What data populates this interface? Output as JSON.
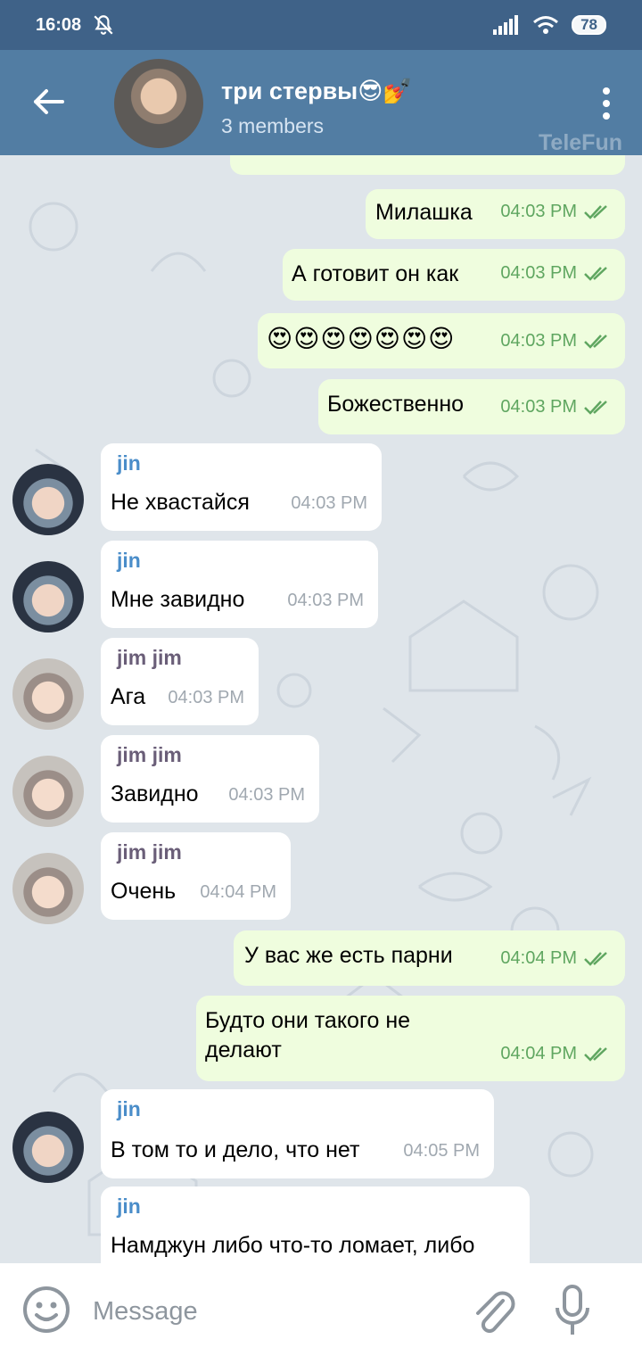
{
  "status_bar": {
    "time": "16:08",
    "battery": "78"
  },
  "header": {
    "title": "три стервы😎💅",
    "subtitle": "3 members",
    "watermark": "TeleFun"
  },
  "messages": [
    {
      "dir": "out",
      "text": "Милашка",
      "time": "04:03 PM"
    },
    {
      "dir": "out",
      "text": "А готовит он как",
      "time": "04:03 PM"
    },
    {
      "dir": "out",
      "text": "😍😍😍😍😍😍😍",
      "time": "04:03 PM"
    },
    {
      "dir": "out",
      "text": "Божественно",
      "time": "04:03 PM"
    },
    {
      "dir": "in",
      "sender": "jin",
      "text": "Не хвастайся",
      "time": "04:03 PM"
    },
    {
      "dir": "in",
      "sender": "jin",
      "text": "Мне завидно",
      "time": "04:03 PM"
    },
    {
      "dir": "in",
      "sender": "jim jim",
      "text": "Ага",
      "time": "04:03 PM"
    },
    {
      "dir": "in",
      "sender": "jim jim",
      "text": "Завидно",
      "time": "04:03 PM"
    },
    {
      "dir": "in",
      "sender": "jim jim",
      "text": "Очень",
      "time": "04:04 PM"
    },
    {
      "dir": "out",
      "text": "У вас же есть парни",
      "time": "04:04 PM"
    },
    {
      "dir": "out",
      "text": "Будто они такого не делают",
      "time": "04:04 PM"
    },
    {
      "dir": "in",
      "sender": "jin",
      "text": "В том то и дело, что нет",
      "time": "04:05 PM"
    },
    {
      "dir": "in",
      "sender": "jin",
      "text": "Намджун либо что-то ломает, либо",
      "time": ""
    }
  ],
  "input": {
    "placeholder": "Message"
  },
  "colors": {
    "header": "#527da3",
    "status_bar": "#3f6288",
    "outgoing_bubble": "#effdde",
    "incoming_bubble": "#ffffff",
    "sender_jin": "#4a8dc9",
    "sender_jimjim": "#6a5e78",
    "read_check": "#5fa660"
  }
}
